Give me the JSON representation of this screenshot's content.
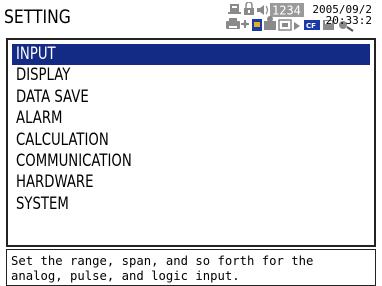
{
  "header": {
    "title": "SETTING",
    "status_indicators": [
      "printer-icon",
      "lock-icon",
      "sound-icon",
      "meter-icon",
      "network-icon",
      "key-lock-icon",
      "cf-card-icon",
      "disk-icon",
      "settings-icon"
    ],
    "counter": "1234",
    "date": "2005/09/2",
    "time": "20:33:2",
    "cf_label": "CF"
  },
  "menu": {
    "items": [
      {
        "label": "INPUT",
        "selected": true
      },
      {
        "label": "DISPLAY",
        "selected": false
      },
      {
        "label": "DATA SAVE",
        "selected": false
      },
      {
        "label": "ALARM",
        "selected": false
      },
      {
        "label": "CALCULATION",
        "selected": false
      },
      {
        "label": "COMMUNICATION",
        "selected": false
      },
      {
        "label": "HARDWARE",
        "selected": false
      },
      {
        "label": "SYSTEM",
        "selected": false
      }
    ]
  },
  "help": {
    "line1": "Set the range, span, and so forth for the",
    "line2": "analog, pulse, and logic input."
  },
  "colors": {
    "selection": "#142b86",
    "selection_text": "#ffffff",
    "text": "#000000",
    "background": "#ffffff",
    "icon_gray": "#8a8a8a",
    "counter_bg": "#9a9a9a"
  }
}
